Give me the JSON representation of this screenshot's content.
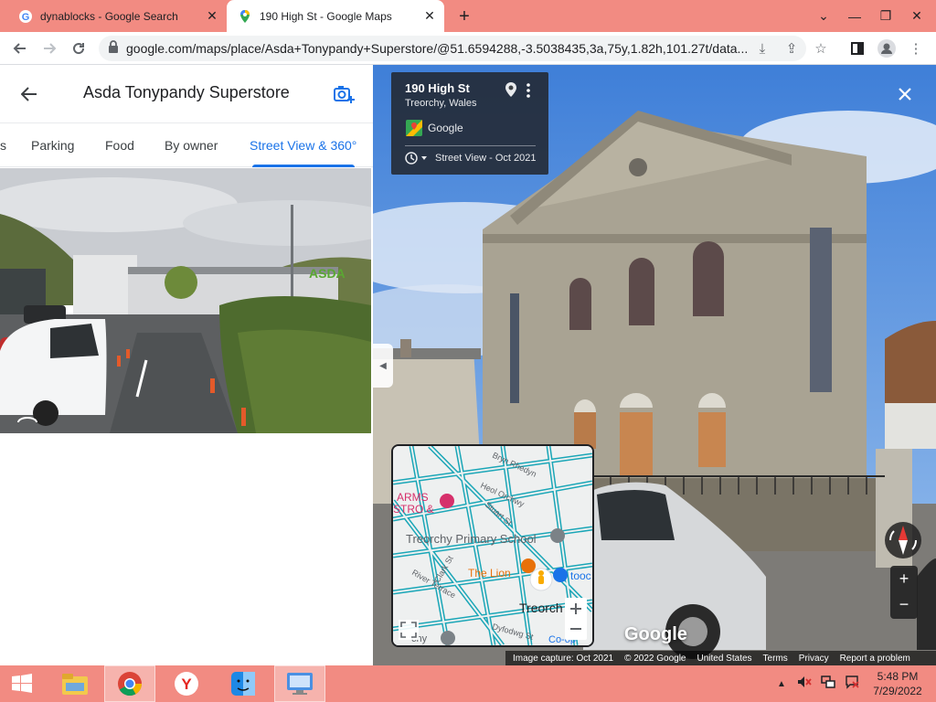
{
  "browser": {
    "tabs": [
      {
        "title": "dynablocks - Google Search",
        "icon": "google-g-icon"
      },
      {
        "title": "190 High St - Google Maps",
        "icon": "maps-pin-icon"
      }
    ],
    "new_tab_icon": "+",
    "url": "google.com/maps/place/Asda+Tonypandy+Superstore/@51.6594288,-3.5038435,3a,75y,1.82h,101.27t/data..."
  },
  "left_panel": {
    "title": "Asda Tonypandy Superstore",
    "tabs": [
      {
        "label": "s"
      },
      {
        "label": "Parking"
      },
      {
        "label": "Food"
      },
      {
        "label": "By owner"
      },
      {
        "label": "Street View & 360°",
        "active": true
      }
    ]
  },
  "street_view": {
    "address": "190 High St",
    "city": "Treorchy, Wales",
    "provider": "Google",
    "date": "Street View - Oct 2021",
    "logo": "Google",
    "minimap_labels": [
      "ARMS",
      "STRO &",
      "Treorchy Primary School",
      "The Lion",
      "Treorch",
      "Co-op",
      "Heol Orchwy",
      "Stuart St",
      "Bryn Rhedyn",
      "Clark St",
      "River Terrace",
      "Dyfodwg St",
      "tooc",
      "chy"
    ],
    "footer": [
      "Image capture: Oct 2021",
      "© 2022 Google",
      "United States",
      "Terms",
      "Privacy",
      "Report a problem"
    ]
  },
  "taskbar": {
    "time": "5:48 PM",
    "date": "7/29/2022"
  }
}
